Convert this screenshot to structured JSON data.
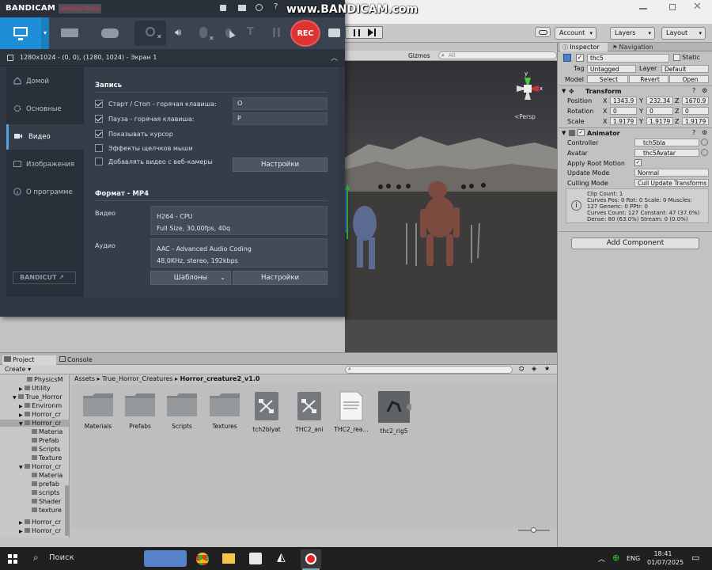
{
  "watermark": "www.BANDICAM.com",
  "unity": {
    "toolbar": {
      "account": "Account",
      "layers": "Layers",
      "layout": "Layout"
    },
    "scene": {
      "gizmos": "Gizmos",
      "search": "All",
      "persp": "<Persp"
    }
  },
  "bandicam": {
    "logo": "BANDICAM",
    "unregistered": "UNREGISTERED",
    "rec_label": "REC",
    "resolution": "1280x1024 - (0, 0), (1280, 1024) - Экран 1",
    "sidebar": [
      {
        "label": "Домой",
        "icon": "home-icon"
      },
      {
        "label": "Основные",
        "icon": "gear-icon"
      },
      {
        "label": "Видео",
        "icon": "video-icon"
      },
      {
        "label": "Изображения",
        "icon": "image-icon"
      },
      {
        "label": "О программе",
        "icon": "info-icon"
      }
    ],
    "bandicut": "BANDICUT ↗",
    "record": {
      "section_title": "Запись",
      "options": [
        {
          "label": "Старт / Стоп - горячая клавиша:",
          "checked": true,
          "value": "O"
        },
        {
          "label": "Пауза - горячая клавиша:",
          "checked": true,
          "value": "P"
        },
        {
          "label": "Показывать курсор",
          "checked": true
        },
        {
          "label": "Эффекты щелчков мыши",
          "checked": false
        },
        {
          "label": "Добавлять видео с веб-камеры",
          "checked": false
        }
      ],
      "settings_button": "Настройки"
    },
    "format": {
      "section_title": "Формат - MP4",
      "video_label": "Видео",
      "video_line1": "H264 - CPU",
      "video_line2": "Full Size, 30,00fps, 40q",
      "audio_label": "Аудио",
      "audio_line1": "AAC - Advanced Audio Coding",
      "audio_line2": "48,0KHz, stereo, 192kbps",
      "templates_button": "Шаблоны",
      "settings_button": "Настройки"
    }
  },
  "inspector": {
    "tab_inspector": "Inspector",
    "tab_navigation": "Navigation",
    "object_name": "thc5",
    "static_label": "Static",
    "tag_label": "Tag",
    "tag_value": "Untagged",
    "layer_label": "Layer",
    "layer_value": "Default",
    "model_label": "Model",
    "model_select": "Select",
    "model_revert": "Revert",
    "model_open": "Open",
    "transform": {
      "title": "Transform",
      "position_label": "Position",
      "position": [
        "1343.9",
        "232.34",
        "1670.9"
      ],
      "rotation_label": "Rotation",
      "rotation": [
        "0",
        "0",
        "0"
      ],
      "scale_label": "Scale",
      "scale": [
        "1.9179",
        "1.9179",
        "1.9179"
      ]
    },
    "animator": {
      "title": "Animator",
      "controller_label": "Controller",
      "controller_value": "tch5bla",
      "avatar_label": "Avatar",
      "avatar_value": "thc5Avatar",
      "apply_root_label": "Apply Root Motion",
      "update_mode_label": "Update Mode",
      "update_mode_value": "Normal",
      "culling_label": "Culling Mode",
      "culling_value": "Cull Update Transforms",
      "info": [
        "Clip Count: 1",
        "Curves Pos: 0 Rot: 0 Scale: 0 Muscles:",
        "127 Generic: 0 PPtr: 0",
        "Curves Count: 127 Constant: 47 (37.0%)",
        "Dense: 80 (63.0%) Stream: 0 (0.0%)"
      ]
    },
    "add_component": "Add Component"
  },
  "project": {
    "tab_project": "Project",
    "tab_console": "Console",
    "create": "Create",
    "breadcrumb": [
      "Assets",
      "True_Horror_Creatures",
      "Horror_creature2_v1.0"
    ],
    "tree": [
      "PhysicsM",
      "Utility",
      "True_Horror",
      "Environm",
      "Horror_cr",
      "Horror_cr",
      "Materia",
      "Prefab",
      "Scripts",
      "Texture",
      "Horror_cr",
      "Materia",
      "prefab",
      "scripts",
      "Shader",
      "texture",
      "Horror_cr",
      "Horror_cr"
    ],
    "assets": [
      {
        "name": "Materials",
        "icon": "folder-icon"
      },
      {
        "name": "Prefabs",
        "icon": "folder-icon"
      },
      {
        "name": "Scripts",
        "icon": "folder-icon"
      },
      {
        "name": "Textures",
        "icon": "folder-icon"
      },
      {
        "name": "tch2blyat",
        "icon": "animator-controller-icon"
      },
      {
        "name": "THC2_ani",
        "icon": "animator-controller-icon"
      },
      {
        "name": "THC2_rea...",
        "icon": "text-document-icon"
      },
      {
        "name": "thc2_rig5",
        "icon": "model-icon"
      }
    ]
  },
  "taskbar": {
    "search": "Поиск",
    "language": "ENG",
    "time": "18:41",
    "date": "01/07/2025"
  }
}
